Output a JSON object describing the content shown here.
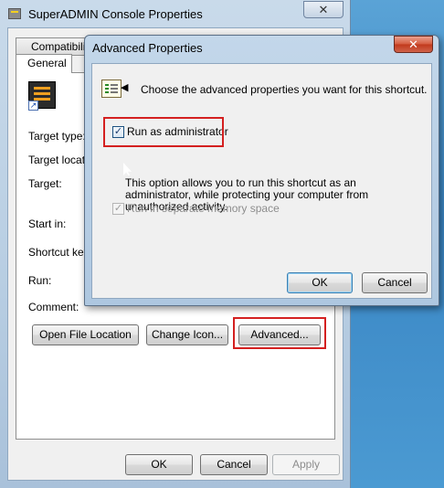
{
  "props_window": {
    "title": "SuperADMIN Console Properties",
    "close_glyph": "✕",
    "tabs": {
      "compatibility": "Compatibility",
      "general": "General"
    },
    "fields": {
      "target_type": "Target type:",
      "target_location": "Target location",
      "target": "Target:",
      "start_in": "Start in:",
      "shortcut_key": "Shortcut key:",
      "run": "Run:",
      "comment": "Comment:"
    },
    "buttons": {
      "open_file_location": "Open File Location",
      "change_icon": "Change Icon...",
      "advanced": "Advanced...",
      "ok": "OK",
      "cancel": "Cancel",
      "apply": "Apply"
    }
  },
  "advanced_dialog": {
    "title": "Advanced Properties",
    "close_glyph": "✕",
    "description": "Choose the advanced properties you want for this shortcut.",
    "run_as_admin": {
      "label": "Run as administrator",
      "checked": true
    },
    "explanation": [
      "This option allows you to run this shortcut as an",
      "administrator, while protecting your computer from",
      "unauthorized activity."
    ],
    "separate_memory": {
      "label": "Run in separate memory space",
      "checked": true,
      "disabled": true
    },
    "buttons": {
      "ok": "OK",
      "cancel": "Cancel"
    }
  },
  "colors": {
    "highlight": "#d42020",
    "close_button": "#c0391b"
  }
}
